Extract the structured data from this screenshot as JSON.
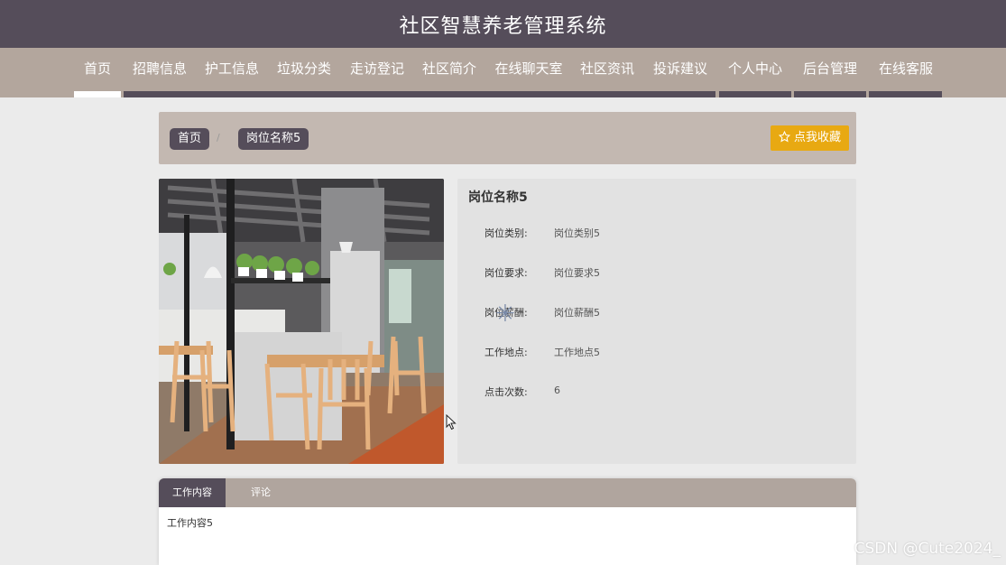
{
  "header": {
    "title": "社区智慧养老管理系统"
  },
  "nav": {
    "items": [
      {
        "label": "首页"
      },
      {
        "label": "招聘信息"
      },
      {
        "label": "护工信息"
      },
      {
        "label": "垃圾分类"
      },
      {
        "label": "走访登记"
      },
      {
        "label": "社区简介"
      },
      {
        "label": "在线聊天室"
      },
      {
        "label": "社区资讯"
      },
      {
        "label": "投诉建议"
      },
      {
        "label": "个人中心"
      },
      {
        "label": "后台管理"
      },
      {
        "label": "在线客服"
      }
    ],
    "active_index": 0
  },
  "breadcrumb": {
    "home": "首页",
    "separator": "/",
    "current": "岗位名称5"
  },
  "favorite": {
    "icon": "star-outline-icon",
    "label": "点我收藏"
  },
  "detail": {
    "name": "岗位名称5",
    "rows": [
      {
        "label": "岗位类别:",
        "value": "岗位类别5"
      },
      {
        "label": "岗位要求:",
        "value": "岗位要求5"
      },
      {
        "label": "岗位薪酬:",
        "value": "岗位薪酬5"
      },
      {
        "label": "工作地点:",
        "value": "工作地点5"
      },
      {
        "label": "点击次数:",
        "value": "6"
      }
    ]
  },
  "tabs": {
    "items": [
      {
        "label": "工作内容"
      },
      {
        "label": "评论"
      }
    ],
    "active_index": 0,
    "content": "工作内容5"
  },
  "watermark": "CSDN @Cute2024_",
  "colors": {
    "header": "#554d5a",
    "nav": "#b3a69d",
    "accent": "#e8a912",
    "breadcrumb_bg": "#c3b8b1"
  }
}
